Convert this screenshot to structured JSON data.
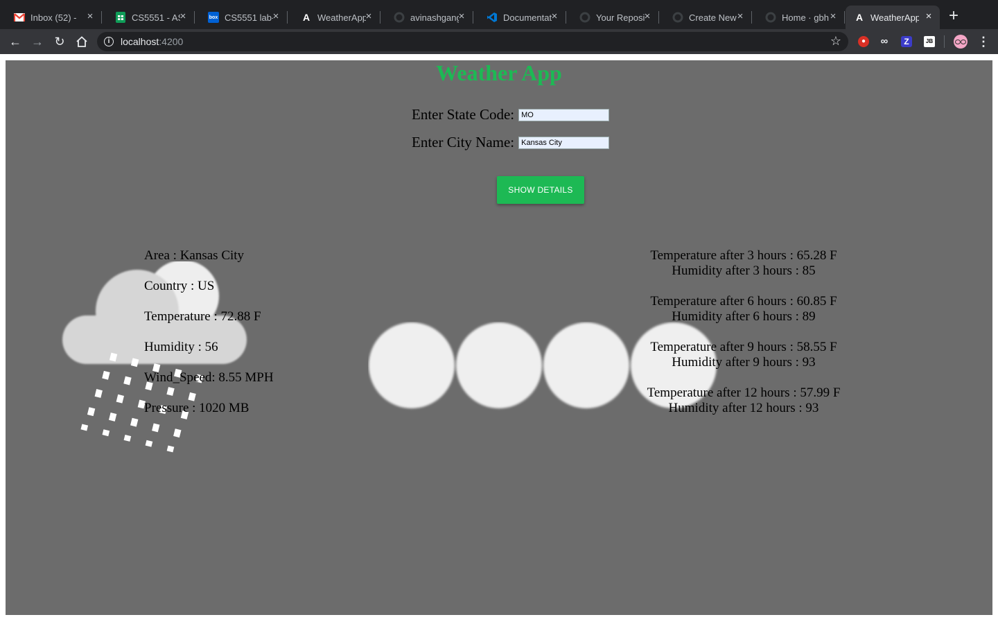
{
  "browser": {
    "tabs": [
      {
        "title": "Inbox (52) -",
        "icon": "gmail-icon",
        "icon_color": "#ea4335",
        "active": false
      },
      {
        "title": "CS5551 - AS",
        "icon": "sheets-icon",
        "icon_color": "#0f9d58",
        "active": false
      },
      {
        "title": "CS5551 lab-",
        "icon": "box-icon",
        "icon_color": "#0061d5",
        "active": false
      },
      {
        "title": "WeatherApp",
        "icon": "angular-icon",
        "icon_color": "#ffffff",
        "active": false
      },
      {
        "title": "avinashgang",
        "icon": "github-icon",
        "icon_color": "#202124",
        "active": false
      },
      {
        "title": "Documentat",
        "icon": "vscode-icon",
        "icon_color": "#0078d4",
        "active": false
      },
      {
        "title": "Your Reposi",
        "icon": "github-icon",
        "icon_color": "#202124",
        "active": false
      },
      {
        "title": "Create New",
        "icon": "github-icon",
        "icon_color": "#202124",
        "active": false
      },
      {
        "title": "Home · gbh",
        "icon": "github-icon",
        "icon_color": "#202124",
        "active": false
      },
      {
        "title": "WeatherApp",
        "icon": "angular-icon",
        "icon_color": "#ffffff",
        "active": true
      }
    ],
    "url_host": "localhost",
    "url_port": ":4200"
  },
  "page": {
    "title": "Weather App",
    "state_label": "Enter State Code:",
    "state_value": "MO",
    "city_label": "Enter City Name:",
    "city_value": "Kansas City",
    "button_label": "SHOW DETAILS",
    "current": {
      "area": "Area : Kansas City",
      "country": "Country : US",
      "temperature": "Temperature : 72.88 F",
      "humidity": "Humidity : 56",
      "wind": "Wind_Speed: 8.55 MPH",
      "pressure": "Pressure : 1020 MB"
    },
    "forecast": [
      {
        "temp": "Temperature after 3 hours : 65.28 F",
        "humidity": "Humidity after 3 hours : 85"
      },
      {
        "temp": "Temperature after 6 hours : 60.85 F",
        "humidity": "Humidity after 6 hours : 89"
      },
      {
        "temp": "Temperature after 9 hours : 58.55 F",
        "humidity": "Humidity after 9 hours : 93"
      },
      {
        "temp": "Temperature after 12 hours : 57.99 F",
        "humidity": "Humidity after 12 hours : 93"
      }
    ],
    "colors": {
      "accent": "#1db954",
      "background": "#6c6c6c"
    },
    "weather_icon": "rain-cloud-icon"
  }
}
